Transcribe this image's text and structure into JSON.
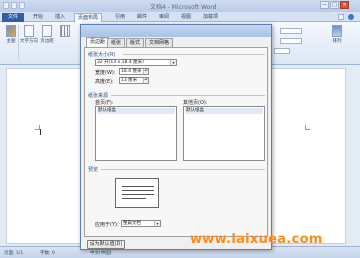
{
  "window": {
    "title": "文档4 - Microsoft Word",
    "controls": [
      "—",
      "□",
      "✕"
    ]
  },
  "tabs": [
    {
      "label": "文件"
    },
    {
      "label": "开始"
    },
    {
      "label": "插入"
    },
    {
      "label": "页面布局"
    },
    {
      "label": "引用"
    },
    {
      "label": "邮件"
    },
    {
      "label": "审阅"
    },
    {
      "label": "视图"
    },
    {
      "label": "加载项"
    }
  ],
  "ribbon": {
    "left_buttons": [
      {
        "label": "主题"
      },
      {
        "label": "文字方向"
      },
      {
        "label": "页边距"
      }
    ],
    "right_button": {
      "label": "排列"
    }
  },
  "dialog": {
    "tabs": [
      "页边距",
      "纸张",
      "版式",
      "文档网格"
    ],
    "paper_size_section": "纸张大小(R)",
    "paper_size_value": "32 开(13 x 18.4 厘米)",
    "width_label": "宽度(W):",
    "width_value": "18.4 厘米",
    "height_label": "高度(E):",
    "height_value": "13 厘米",
    "paper_source_section": "纸张来源",
    "first_page_label": "首页(F):",
    "first_page_value": "默认纸盒",
    "other_pages_label": "其他页(O):",
    "other_pages_value": "默认纸盒",
    "preview_section": "预览",
    "apply_to_label": "应用于(Y):",
    "apply_to_value": "整篇文档",
    "set_default_button": "设为默认值(D)"
  },
  "statusbar": {
    "page": "页面: 1/1",
    "words": "字数: 0",
    "language": "中文(中国)"
  },
  "watermark": "www.laixuea.com"
}
